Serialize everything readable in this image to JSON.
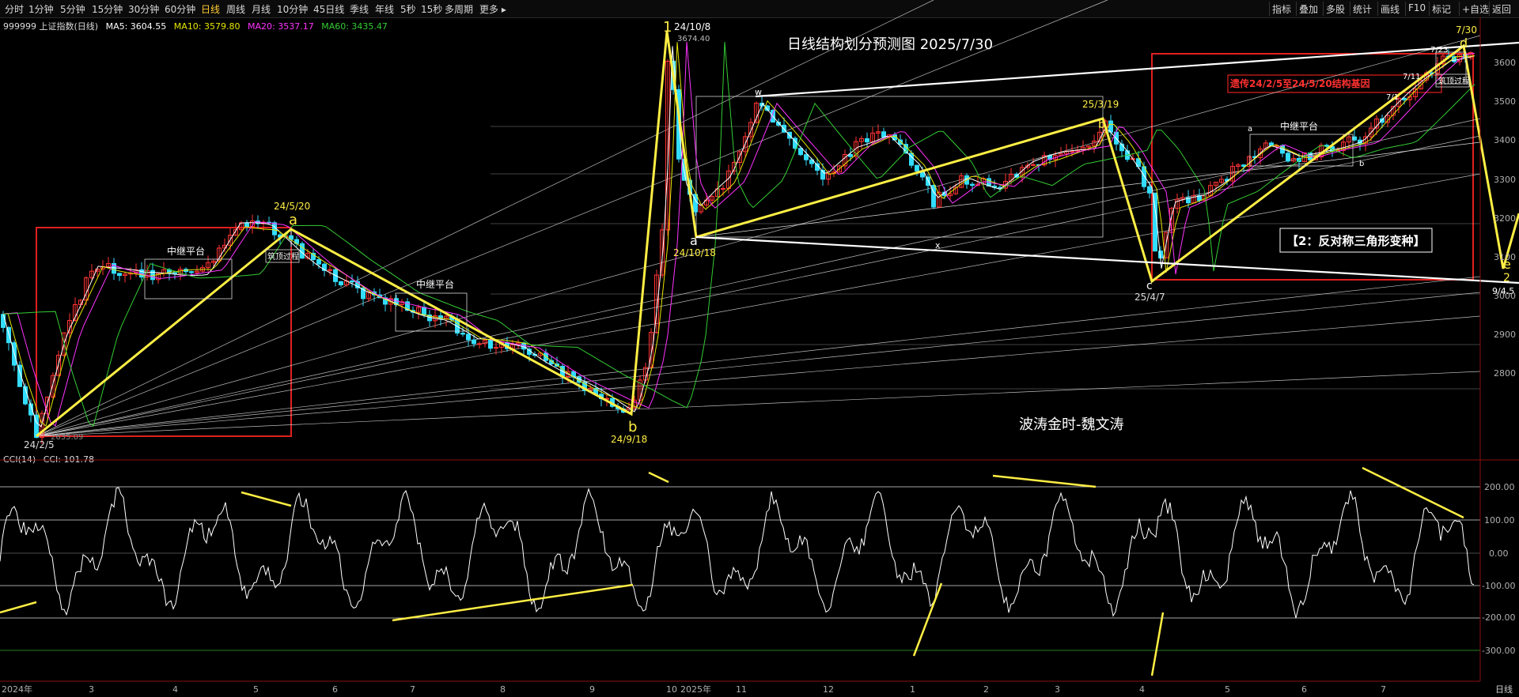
{
  "toolbar": {
    "timeframes": [
      {
        "label": "分时"
      },
      {
        "label": "1分钟"
      },
      {
        "label": "5分钟"
      },
      {
        "label": "15分钟"
      },
      {
        "label": "30分钟"
      },
      {
        "label": "60分钟"
      },
      {
        "label": "日线",
        "active": true
      },
      {
        "label": "周线"
      },
      {
        "label": "月线"
      },
      {
        "label": "10分钟"
      },
      {
        "label": "45日线"
      },
      {
        "label": "季线"
      },
      {
        "label": "年线"
      },
      {
        "label": "5秒"
      },
      {
        "label": "15秒"
      },
      {
        "label": "多周期"
      },
      {
        "label": "更多 ▸"
      }
    ],
    "tools": [
      {
        "label": "指标"
      },
      {
        "label": "叠加"
      },
      {
        "label": "多股"
      },
      {
        "label": "统计"
      },
      {
        "label": "画线"
      },
      {
        "label": "F10"
      },
      {
        "label": "标记"
      },
      {
        "label": "+自选"
      },
      {
        "label": "返回"
      }
    ]
  },
  "main_indicators": {
    "symbol": "999999 上证指数(日线)",
    "ma5": "MA5: 3604.55",
    "ma10": "MA10: 3579.80",
    "ma20": "MA20: 3537.17",
    "ma60": "MA60: 3435.47",
    "colors": {
      "ma5": "#ffffff",
      "ma10": "#e6e600",
      "ma20": "#ff33ff",
      "ma60": "#33cc33"
    }
  },
  "cci_indicators": {
    "name": "CCI(14)",
    "value": "CCI: 101.78"
  },
  "annotations": {
    "title": "日线结构划分预测图  2025/7/30",
    "author": "波涛金时-魏文涛",
    "pattern_label": "【2：反对称三角形变种】",
    "red_note": "遗传24/2/5至24/5/20结构基因",
    "relay1": "中继平台",
    "relay2": "中继平台",
    "relay3": "中继平台",
    "top1": "筑顶过程",
    "top2": "筑顶过程",
    "points": {
      "start": "24/2/5",
      "low_price": "2635.09",
      "a1_label": "a",
      "a1_date": "24/5/20",
      "b1_label": "b",
      "b1_date": "24/9/18",
      "w1_label": "1",
      "w1_date": "24/10/8",
      "high_price": "3674.40",
      "a2_label": "a",
      "a2_date": "24/10/18",
      "w_label": "w",
      "x_label": "x",
      "b2_label": "b",
      "b2_date": "25/3/19",
      "c_label": "c",
      "c_date": "25/4/7",
      "d_label": "d",
      "d_date": "7/30",
      "d_date2": "7/23",
      "jul11": "7/11",
      "jul1": "7/1",
      "e_label": "e",
      "e2_label": "2",
      "e_date": "9/4.5",
      "small_a": "a",
      "small_b": "b"
    }
  },
  "y_axis": {
    "labels": [
      "3600",
      "3500",
      "3400",
      "3300",
      "3200",
      "3100",
      "3000",
      "2900",
      "2800"
    ]
  },
  "cci_axis": {
    "labels": [
      "200.00",
      "100.00",
      "0.00",
      "-100.00",
      "-200.00",
      "-300.00"
    ]
  },
  "x_axis": {
    "labels": [
      "2024年",
      "3",
      "4",
      "5",
      "6",
      "7",
      "8",
      "9",
      "10",
      "2025年",
      "11",
      "12",
      "1",
      "2",
      "3",
      "4",
      "5",
      "6",
      "7"
    ],
    "corner": "日线"
  },
  "colors": {
    "background": "#000000",
    "up": "#ff3333",
    "down": "#33ddff",
    "wave": "#ffee44",
    "frame": "#e02020",
    "cci": "#ffffff"
  }
}
